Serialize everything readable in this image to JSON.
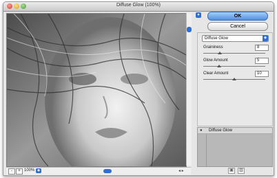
{
  "window": {
    "title": "Diffuse Glow (100%)"
  },
  "footer": {
    "zoom_minus": "-",
    "zoom_plus": "+",
    "zoom_value": "100%"
  },
  "dialog": {
    "ok_label": "OK",
    "cancel_label": "Cancel"
  },
  "filter": {
    "selected": "Diffuse Glow",
    "params": [
      {
        "label": "Graininess",
        "value": "8"
      },
      {
        "label": "Glow Amount",
        "value": "5"
      },
      {
        "label": "Clear Amount",
        "value": "10"
      }
    ],
    "slider_fractions": [
      0.27,
      0.25,
      0.5
    ]
  },
  "layers": {
    "items": [
      {
        "name": "Diffuse Glow"
      }
    ]
  }
}
